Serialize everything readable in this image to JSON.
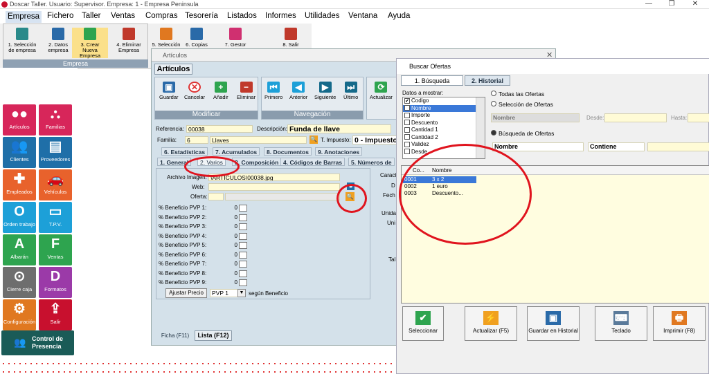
{
  "app": {
    "title": "Doscar Taller. Usuario: Supervisor. Empresa: 1 - Empresa Peninsula"
  },
  "window_controls": [
    "—",
    "❐",
    "✕"
  ],
  "menu": [
    "Empresa",
    "Fichero",
    "Taller",
    "Ventas",
    "Compras",
    "Tesorería",
    "Listados",
    "Informes",
    "Utilidades",
    "Ventana",
    "Ayuda"
  ],
  "ribbon": {
    "group_label": "Empresa",
    "buttons": [
      {
        "l1": "1. Selección",
        "l2": "de empresa",
        "color": "#2a8a8a",
        "icon": "house-icon"
      },
      {
        "l1": "2. Datos",
        "l2": "empresa",
        "color": "#2a6aa8",
        "icon": "folder-icon"
      },
      {
        "l1": "3. Crear",
        "l2": "Nueva Empresa",
        "color": "#2ea44f",
        "icon": "new-icon"
      },
      {
        "l1": "4. Eliminar",
        "l2": "Empresa",
        "color": "#c0392b",
        "icon": "delete-icon"
      },
      {
        "l1": "5. Selección",
        "l2": "",
        "color": "#e07820",
        "icon": "users-icon"
      },
      {
        "l1": "6. Copias",
        "l2": "",
        "color": "#2a6aa8",
        "icon": "lock-icon"
      },
      {
        "l1": "7. Gestor",
        "l2": "",
        "color": "#d03070",
        "icon": "archive-icon"
      },
      {
        "l1": "8. Salir",
        "l2": "",
        "color": "#c0392b",
        "icon": "exit-icon"
      }
    ]
  },
  "tiles": [
    {
      "label": "Artículos",
      "color": "#d7265a",
      "glyph": "●●"
    },
    {
      "label": "Familias",
      "color": "#d7265a",
      "glyph": "⛬"
    },
    {
      "label": "Clientes",
      "color": "#1f6fa8",
      "glyph": "👥"
    },
    {
      "label": "Proveedores",
      "color": "#1f6fa8",
      "glyph": "▤"
    },
    {
      "label": "Empleados",
      "color": "#e8622c",
      "glyph": "✚"
    },
    {
      "label": "Vehículos",
      "color": "#e8622c",
      "glyph": "🚗"
    },
    {
      "label": "Orden trabajo",
      "color": "#1da0d8",
      "glyph": "O"
    },
    {
      "label": "T.P.V.",
      "color": "#1da0d8",
      "glyph": "▭"
    },
    {
      "label": "Albarán",
      "color": "#2ea44f",
      "glyph": "A"
    },
    {
      "label": "Ventas",
      "color": "#2ea44f",
      "glyph": "F"
    },
    {
      "label": "Cierre caja",
      "color": "#6e6e6e",
      "glyph": "⊙"
    },
    {
      "label": "Formatos",
      "color": "#9b3aa8",
      "glyph": "D"
    },
    {
      "label": "Configuración",
      "color": "#e07820",
      "glyph": "⚙"
    },
    {
      "label": "Salir",
      "color": "#c8102e",
      "glyph": "⇪"
    }
  ],
  "control": {
    "l1": "Control de",
    "l2": "Presencia"
  },
  "articulos": {
    "window_title": "Artículos",
    "tab": "Artículos",
    "modificar": {
      "label": "Modificar",
      "buttons": [
        "Guardar",
        "Cancelar",
        "Añadir",
        "Eliminar"
      ]
    },
    "navegacion": {
      "label": "Navegación",
      "buttons": [
        "Primero",
        "Anterior",
        "Siguiente",
        "Último"
      ]
    },
    "actualizar": "Actualizar",
    "referencia_label": "Referencia:",
    "referencia": "00038",
    "descripcion_label": "Descripción:",
    "descripcion": "Funda de llave",
    "familia_label": "Familia:",
    "familia_code": "6",
    "familia_name": "Llaves",
    "impuesto_label": "T. Impuesto:",
    "impuesto": "0 - Impuesto",
    "tabs_row1": [
      "6. Estadísticas",
      "7. Acumulados",
      "8. Documentos",
      "9. Anotaciones"
    ],
    "tabs_row2": [
      "1. General",
      "2. Varios",
      "3. Composición",
      "4. Códigos de Barras",
      "5. Números de"
    ],
    "archivo_label": "Archivo Imagen:",
    "archivo": "\\ARTICULOS\\00038.jpg",
    "web_label": "Web:",
    "oferta_label": "Oferta:",
    "beneficios": [
      "% Beneficio PVP 1:",
      "% Beneficio PVP 2:",
      "% Beneficio PVP 3:",
      "% Beneficio PVP 4:",
      "% Beneficio PVP 5:",
      "% Beneficio PVP 6:",
      "% Beneficio PVP 7:",
      "% Beneficio PVP 8:",
      "% Beneficio PVP 9:"
    ],
    "beneficio_value": "0",
    "ajustar": "Ajustar Precio",
    "pvp_select": "PVP 1",
    "segun": "según Beneficio",
    "right_labels": [
      "Caract",
      "D",
      "Fech",
      "Unida",
      "Uni",
      "Tal"
    ],
    "bottom_tabs": [
      "Ficha (F11)",
      "Lista (F12)"
    ]
  },
  "buscar": {
    "title": "Buscar Ofertas",
    "tabs": [
      "1. Búsqueda",
      "2. Historial"
    ],
    "datos_label": "Datos a mostrar:",
    "datos": [
      {
        "label": "Codigo",
        "checked": true
      },
      {
        "label": "Nombre",
        "checked": true
      },
      {
        "label": "Importe",
        "checked": false
      },
      {
        "label": "Descuento",
        "checked": false
      },
      {
        "label": "Cantidad 1",
        "checked": false
      },
      {
        "label": "Cantidad 2",
        "checked": false
      },
      {
        "label": "Validez",
        "checked": false
      },
      {
        "label": "Desde",
        "checked": false
      }
    ],
    "radios": [
      "Todas las Ofertas",
      "Selección de Ofertas"
    ],
    "range_field": "Nombre",
    "desde": "Desde:",
    "hasta": "Hasta:",
    "busqueda_radio": "Búsqueda de Ofertas",
    "search_field": "Nombre",
    "search_op": "Contiene",
    "columns": [
      "Co...",
      "Nombre"
    ],
    "rows": [
      {
        "code": "0001",
        "name": "3 x 2"
      },
      {
        "code": "0002",
        "name": "1 euro"
      },
      {
        "code": "0003",
        "name": "Descuento..."
      }
    ],
    "buttons": [
      {
        "label": "Seleccionar",
        "color": "#2ea44f",
        "glyph": "✔"
      },
      {
        "label": "Actualizar (F5)",
        "color": "#f0a020",
        "glyph": "⚡"
      },
      {
        "label": "Guardar en Historial",
        "color": "#2a6aa8",
        "glyph": "▣"
      },
      {
        "label": "Teclado",
        "color": "#5a7a9a",
        "glyph": "⌨"
      },
      {
        "label": "Imprimir (F8)",
        "color": "#e07820",
        "glyph": "🖶"
      }
    ]
  }
}
